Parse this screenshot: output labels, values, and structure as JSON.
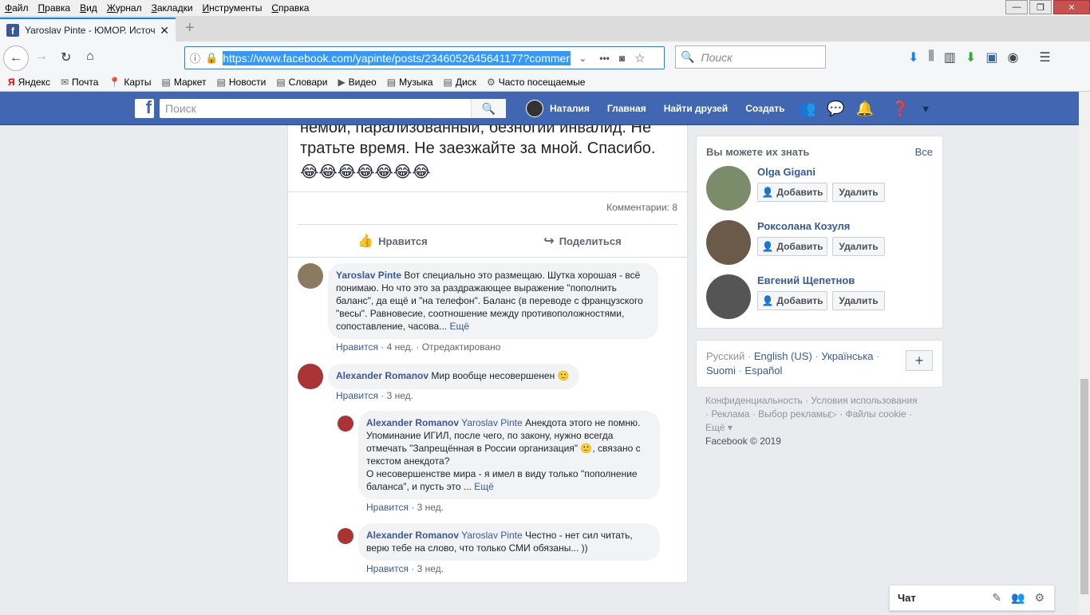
{
  "menubar": {
    "items": [
      "Файл",
      "Правка",
      "Вид",
      "Журнал",
      "Закладки",
      "Инструменты",
      "Справка"
    ]
  },
  "tab": {
    "title": "Yaroslav Pinte - ЮМОР. Источ",
    "favicon": "f"
  },
  "nav": {
    "url": "https://www.facebook.com/yapinte/posts/2346052645641177?commer",
    "search_placeholder": "Поиск"
  },
  "bookmarks": [
    "Яндекс",
    "Почта",
    "Карты",
    "Маркет",
    "Новости",
    "Словари",
    "Видео",
    "Музыка",
    "Диск",
    "Часто посещаемые"
  ],
  "fb": {
    "search_placeholder": "Поиск",
    "user": "Наталия",
    "nav_home": "Главная",
    "nav_find": "Найти друзей",
    "nav_create": "Создать"
  },
  "post": {
    "text_line1": "немой, парализованный, безногий инвалид. Не",
    "text_line2": "тратьте время. Не заезжайте за мной. Спасибо.",
    "emojis": "😂😂😂😂😂😂😂",
    "comments_count": "Комментарии: 8",
    "like": "Нравится",
    "share": "Поделиться"
  },
  "comments": [
    {
      "author": "Yaroslav Pinte",
      "text": "Вот специально это размещаю. Шутка хорошая - всё понимаю. Но что это за раздражающее выражение \"пополнить баланс\", да ещё и \"на телефон\". Баланс (в переводе с французского \"весы\". Равновесие, соотношение между противоположностями, сопоставление, часова...",
      "more": "Ещё",
      "like": "Нравится",
      "time": "4 нед.",
      "edited": "Отредактировано"
    },
    {
      "author": "Alexander Romanov",
      "text": "Мир вообще несовершенен 🙂",
      "like": "Нравится",
      "time": "3 нед."
    },
    {
      "author": "Alexander Romanov",
      "mention": "Yaroslav Pinte",
      "text": "Анекдота этого не помню. Упоминание ИГИЛ, после чего, по закону, нужно всегда отмечать \"Запрещённая в России организация\" 🙂, связано с текстом анекдота?",
      "text2": "О несовершенстве мира - я имел в виду только \"пополнение баланса\", и пусть это ...",
      "more": "Ещё",
      "like": "Нравится",
      "time": "3 нед."
    },
    {
      "author": "Alexander Romanov",
      "mention": "Yaroslav Pinte",
      "text": "Честно - нет сил читать, верю тебе на слово, что только СМИ обязаны... ))",
      "like": "Нравится",
      "time": "3 нед."
    }
  ],
  "pymk": {
    "title": "Вы можете их знать",
    "all": "Все",
    "add": "Добавить",
    "remove": "Удалить",
    "people": [
      "Olga Gigani",
      "Роксолана Козуля",
      "Евгений Щепетнов"
    ]
  },
  "langs": {
    "current": "Русский",
    "l1": "English (US)",
    "l2": "Українська",
    "l3": "Suomi",
    "l4": "Español",
    "plus": "+"
  },
  "footer": {
    "l1": "Конфиденциальность",
    "l2": "Условия использования",
    "l3": "Реклама",
    "l4": "Выбор рекламы",
    "l5": "Файлы cookie",
    "l6": "Ещё",
    "copyright": "Facebook © 2019"
  },
  "chat": {
    "label": "Чат"
  }
}
